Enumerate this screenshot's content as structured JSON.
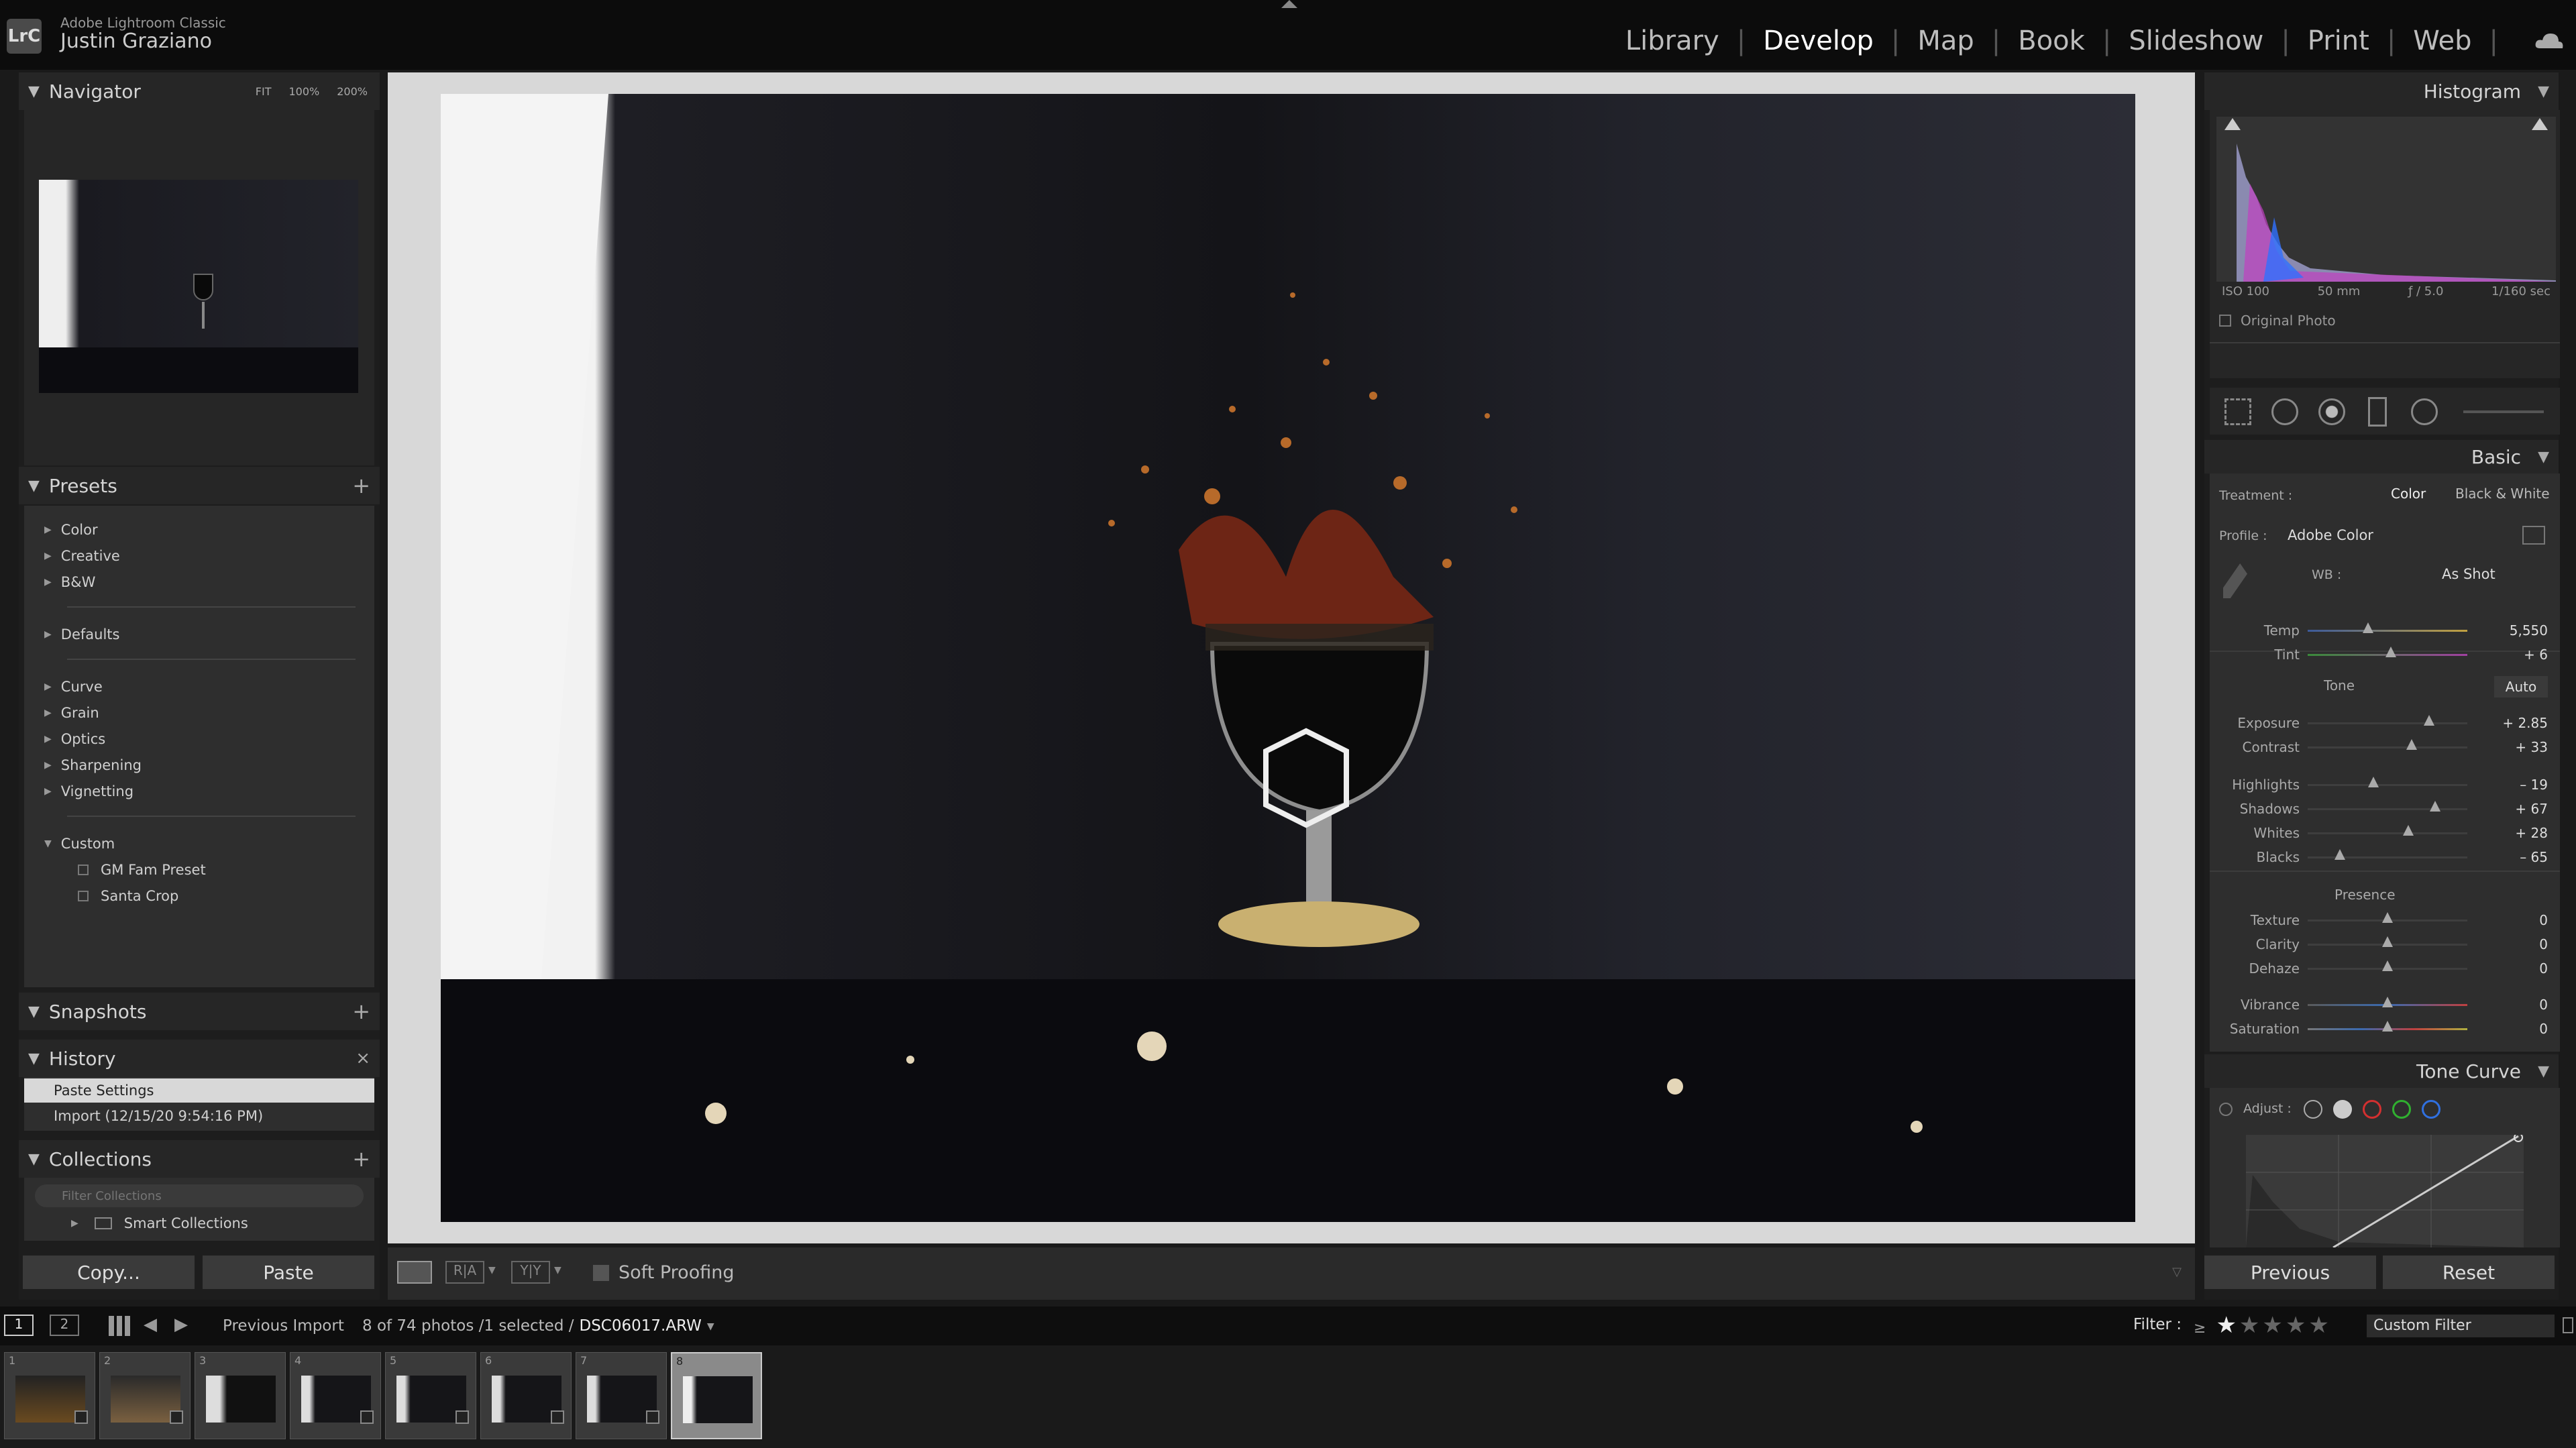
{
  "header": {
    "app_name": "Adobe Lightroom Classic",
    "user_name": "Justin Graziano",
    "logo_text": "LrC",
    "modules": [
      {
        "label": "Library"
      },
      {
        "label": "Develop",
        "active": true
      },
      {
        "label": "Map"
      },
      {
        "label": "Book"
      },
      {
        "label": "Slideshow"
      },
      {
        "label": "Print"
      },
      {
        "label": "Web"
      }
    ]
  },
  "navigator": {
    "title": "Navigator",
    "zoom": [
      "FIT",
      "100%",
      "200%"
    ]
  },
  "presets": {
    "title": "Presets",
    "groups": [
      "Color",
      "Creative",
      "B&W",
      "Defaults",
      "Curve",
      "Grain",
      "Optics",
      "Sharpening",
      "Vignetting",
      "Custom"
    ],
    "custom_items": [
      "GM Fam Preset",
      "Santa Crop"
    ]
  },
  "snapshots": {
    "title": "Snapshots"
  },
  "history": {
    "title": "History",
    "items": [
      "Paste Settings",
      "Import (12/15/20 9:54:16 PM)"
    ]
  },
  "collections": {
    "title": "Collections",
    "search_placeholder": "Filter Collections",
    "items": [
      "Smart Collections"
    ]
  },
  "left_buttons": {
    "copy": "Copy...",
    "paste": "Paste"
  },
  "toolbar": {
    "soft_proofing": "Soft Proofing"
  },
  "histogram": {
    "title": "Histogram",
    "iso": "ISO 100",
    "focal": "50 mm",
    "aperture": "ƒ / 5.0",
    "shutter": "1/160 sec",
    "original_photo": "Original Photo"
  },
  "basic": {
    "title": "Basic",
    "treatment_label": "Treatment :",
    "treatment_color": "Color",
    "treatment_bw": "Black & White",
    "profile_label": "Profile :",
    "profile_value": "Adobe Color",
    "wb_label": "WB :",
    "wb_value": "As Shot",
    "tone_label": "Tone",
    "auto_label": "Auto",
    "presence_label": "Presence",
    "sliders": [
      {
        "label": "Temp",
        "value": "5,550",
        "pos": 0.38
      },
      {
        "label": "Tint",
        "value": "+ 6",
        "pos": 0.52
      },
      {
        "label": "Exposure",
        "value": "+ 2.85",
        "pos": 0.76
      },
      {
        "label": "Contrast",
        "value": "+ 33",
        "pos": 0.65
      },
      {
        "label": "Highlights",
        "value": "– 19",
        "pos": 0.41
      },
      {
        "label": "Shadows",
        "value": "+ 67",
        "pos": 0.8
      },
      {
        "label": "Whites",
        "value": "+ 28",
        "pos": 0.63
      },
      {
        "label": "Blacks",
        "value": "– 65",
        "pos": 0.2
      },
      {
        "label": "Texture",
        "value": "0",
        "pos": 0.5
      },
      {
        "label": "Clarity",
        "value": "0",
        "pos": 0.5
      },
      {
        "label": "Dehaze",
        "value": "0",
        "pos": 0.5
      },
      {
        "label": "Vibrance",
        "value": "0",
        "pos": 0.5
      },
      {
        "label": "Saturation",
        "value": "0",
        "pos": 0.5
      }
    ]
  },
  "tone_curve": {
    "title": "Tone Curve",
    "adjust_label": "Adjust :"
  },
  "right_buttons": {
    "previous": "Previous",
    "reset": "Reset"
  },
  "filmstrip_bar": {
    "source": "Previous Import",
    "count": "8 of 74 photos /1 selected /",
    "filename": "DSC06017.ARW",
    "filter_label": "Filter :",
    "filter_value": "Custom Filter",
    "view_1": "1",
    "view_2": "2"
  },
  "thumbnails": [
    "1",
    "2",
    "3",
    "4",
    "5",
    "6",
    "7",
    "8"
  ]
}
